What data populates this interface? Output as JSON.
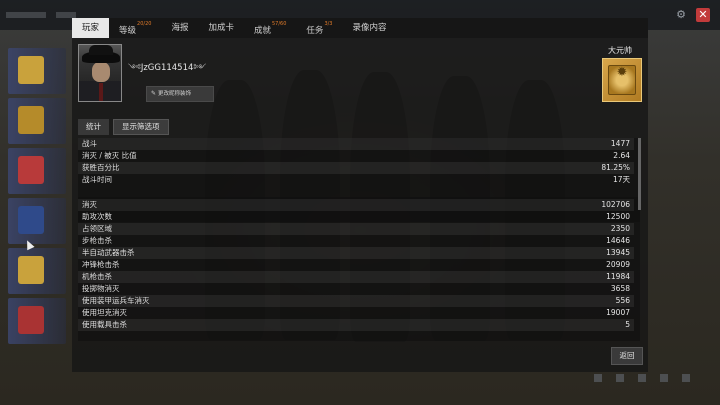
{
  "window": {
    "close_icon": "close-icon"
  },
  "tabs": [
    {
      "label": "玩家",
      "sup": ""
    },
    {
      "label": "等级",
      "sup": "20/20"
    },
    {
      "label": "海报",
      "sup": ""
    },
    {
      "label": "加成卡",
      "sup": ""
    },
    {
      "label": "成就",
      "sup": "57/60"
    },
    {
      "label": "任务",
      "sup": "3/3"
    },
    {
      "label": "录像内容",
      "sup": ""
    }
  ],
  "player": {
    "name": "JzGG114514",
    "change_button": "更改昵称装饰"
  },
  "rank": {
    "title": "大元帅",
    "accent": "#d8a64b"
  },
  "sub_tabs": {
    "stats": "统计",
    "filter": "显示筛选项"
  },
  "stats_group1": [
    {
      "label": "战斗",
      "value": "1477"
    },
    {
      "label": "消灭 / 被灭 比值",
      "value": "2.64"
    },
    {
      "label": "获胜百分比",
      "value": "81.25%"
    },
    {
      "label": "战斗时间",
      "value": "17天"
    }
  ],
  "stats_group2": [
    {
      "label": "消灭",
      "value": "102706"
    },
    {
      "label": "助攻次数",
      "value": "12500"
    },
    {
      "label": "占领区域",
      "value": "2350"
    },
    {
      "label": "步枪击杀",
      "value": "14646"
    },
    {
      "label": "半自动武器击杀",
      "value": "13945"
    },
    {
      "label": "冲锋枪击杀",
      "value": "20909"
    },
    {
      "label": "机枪击杀",
      "value": "11984"
    },
    {
      "label": "投掷物消灭",
      "value": "3658"
    },
    {
      "label": "使用装甲运兵车消灭",
      "value": "556"
    },
    {
      "label": "使用坦克消灭",
      "value": "19007"
    },
    {
      "label": "使用载具击杀",
      "value": "5"
    }
  ],
  "back_button": "返回"
}
